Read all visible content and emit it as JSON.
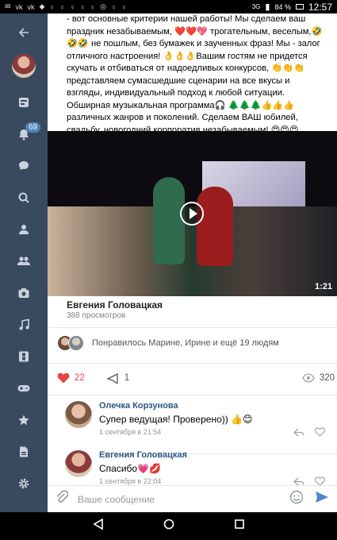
{
  "status_bar": {
    "battery": "84 %",
    "time": "12:57",
    "net": "3G"
  },
  "sidebar": {
    "notifications_badge": "69"
  },
  "post": {
    "text": "- вот основные критерии нашей работы! Мы сделаем ваш праздник незабываемым, ❤️❤️💖 трогательным, веселым,🤣🤣🤣 не пошлым, без бумажек и заученных фраз! Мы - залог отличного настроения! 👌👌👌Вашим гостям не придется скучать и отбиваться от надоедливых конкурсов, 👏👏👏представляем сумасшедшие сценарии на все вкусы и взгляды, индивидуальный подход к любой ситуации. Обширная музыкальная программа🎧 🌲🌲🌲👍👍👍 различных жанров и поколений. Сделаем ВАШ юбилей, свадьбу, новогодний корпоратив незабываемым! 😍😍😍",
    "video_duration": "1:21",
    "author": "Евгения Головацкая",
    "views_count": "388 просмотров",
    "liked_by": "Понравилось Марине, Ирине и ещё 19 людям",
    "likes": "22",
    "shares": "1",
    "views": "320"
  },
  "comments": [
    {
      "name": "Олечка Корзунова",
      "text": "Супер ведущая! Проверено)) 👍😊",
      "date": "1 сентября в 21:54"
    },
    {
      "name": "Евгения Головацкая",
      "text": "Спасибо💗💋",
      "date": "1 сентября в 22:04"
    }
  ],
  "composer": {
    "placeholder": "Ваше сообщение"
  },
  "colors": {
    "sidebar": "#3a4a5e",
    "link": "#2a5885",
    "like": "#e64646",
    "accent": "#4986cc"
  }
}
